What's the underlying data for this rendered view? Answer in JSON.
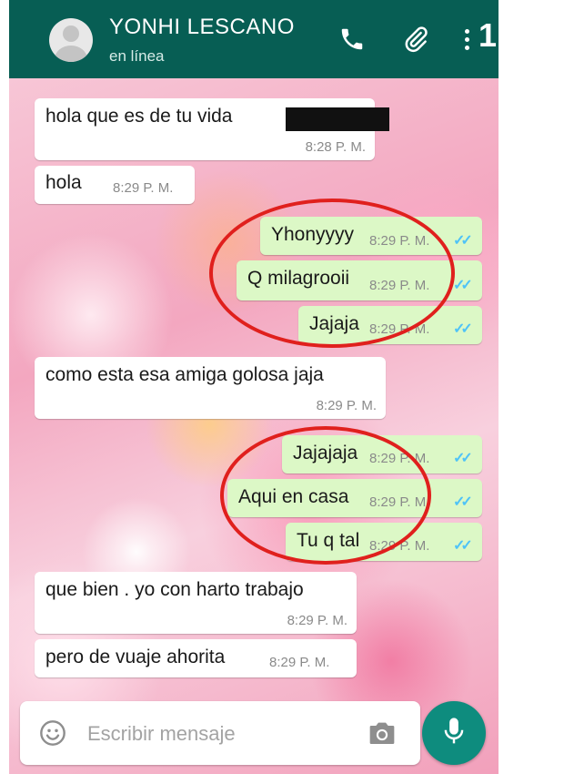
{
  "header": {
    "contact_name": "YONHI LESCANO",
    "status": "en línea",
    "overlay_number": "1",
    "icons": [
      "avatar",
      "phone-icon",
      "paperclip-icon",
      "more-vertical-icon"
    ]
  },
  "messages": [
    {
      "dir": "in",
      "text": "hola que es de tu vida",
      "time": "8:28 P. M.",
      "redacted": true
    },
    {
      "dir": "in",
      "text": "hola",
      "time": "8:29 P. M."
    },
    {
      "dir": "out",
      "text": "Yhonyyyy",
      "time": "8:29 P. M.",
      "status": "read"
    },
    {
      "dir": "out",
      "text": "Q milagrooii",
      "time": "8:29 P. M.",
      "status": "read"
    },
    {
      "dir": "out",
      "text": "Jajaja",
      "time": "8:29 P. M.",
      "status": "read"
    },
    {
      "dir": "in",
      "text": "como esta esa amiga golosa jaja",
      "time": "8:29 P. M."
    },
    {
      "dir": "out",
      "text": "Jajajaja",
      "time": "8:29 P. M.",
      "status": "read"
    },
    {
      "dir": "out",
      "text": "Aqui en casa",
      "time": "8:29 P. M.",
      "status": "read"
    },
    {
      "dir": "out",
      "text": "Tu q tal",
      "time": "8:29 P. M.",
      "status": "read"
    },
    {
      "dir": "in",
      "text": "que bien . yo con harto trabajo",
      "time": "8:29 P. M."
    },
    {
      "dir": "in",
      "text": "pero de vuaje ahorita",
      "time": "8:29 P. M."
    }
  ],
  "read_checks": "✓✓",
  "input": {
    "placeholder": "Escribir mensaje",
    "value": ""
  },
  "colors": {
    "header": "#075e54",
    "outgoing_bubble": "#dcf8c6",
    "incoming_bubble": "#ffffff",
    "read_checks": "#4fc3f7",
    "annotation_ring": "#e0201d",
    "mic_button": "#0e8c7e"
  }
}
